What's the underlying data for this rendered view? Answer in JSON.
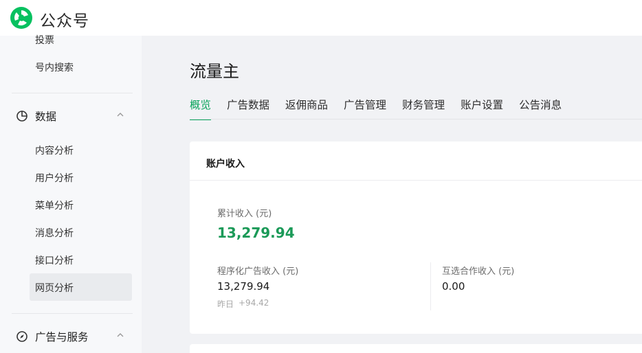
{
  "header": {
    "brand": "公众号",
    "logo_icon": "wechat-mp-logo-icon"
  },
  "sidebar": {
    "items_top": [
      {
        "label": "投票"
      },
      {
        "label": "号内搜索"
      }
    ],
    "data_section": {
      "title": "数据",
      "icon": "pie-chart-icon",
      "items": [
        {
          "label": "内容分析"
        },
        {
          "label": "用户分析"
        },
        {
          "label": "菜单分析"
        },
        {
          "label": "消息分析"
        },
        {
          "label": "接口分析"
        },
        {
          "label": "网页分析"
        }
      ]
    },
    "ads_section": {
      "title": "广告与服务",
      "icon": "compass-icon"
    }
  },
  "main": {
    "title": "流量主",
    "tabs": [
      "概览",
      "广告数据",
      "返佣商品",
      "广告管理",
      "财务管理",
      "账户设置",
      "公告消息"
    ],
    "active_tab": "概览",
    "card": {
      "title": "账户收入",
      "total_label": "累计收入 (元)",
      "total_value": "13,279.94",
      "programmatic_label": "程序化广告收入 (元)",
      "programmatic_value": "13,279.94",
      "yesterday_label": "昨日",
      "yesterday_value": "+94.42",
      "mutual_label": "互选合作收入 (元)",
      "mutual_value": "0.00"
    }
  },
  "colors": {
    "accent": "#07a35a",
    "total_value": "#1b9a58"
  }
}
